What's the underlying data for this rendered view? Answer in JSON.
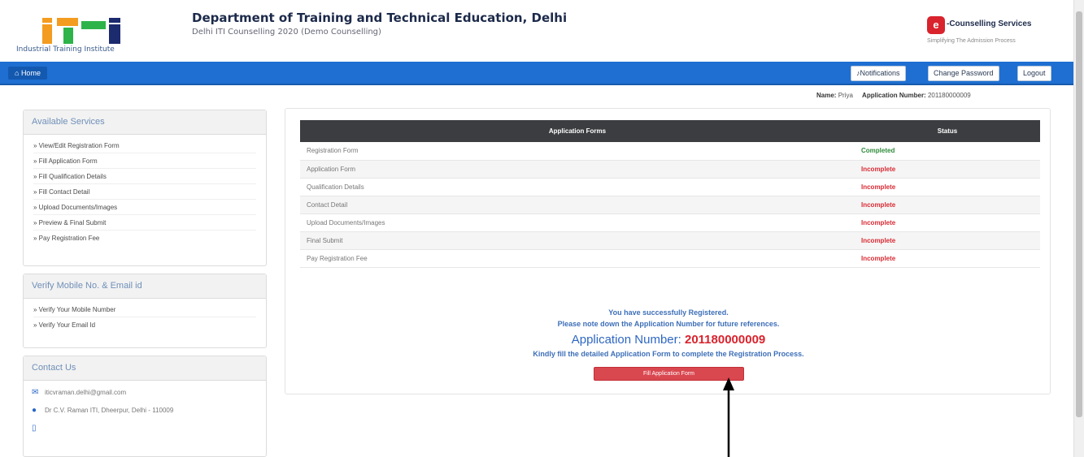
{
  "header": {
    "logo_caption": "Industrial Training Institute",
    "title": "Department of Training and Technical Education, Delhi",
    "subtitle": "Delhi ITI Counselling 2020 (Demo Counselling)",
    "brand_mark": "e",
    "brand_name": "-Counselling Services",
    "brand_tagline": "Simplifying The Admission Process",
    "logo_colors": {
      "orange": "#f39c1f",
      "green": "#2eb34a",
      "navy": "#1c2a6e"
    }
  },
  "nav": {
    "home_label": "Home",
    "notifications_label": "Notifications",
    "change_password_label": "Change Password",
    "logout_label": "Logout",
    "bar_color": "#1e6fd1"
  },
  "user": {
    "name_label": "Name:",
    "name_value": "Priya",
    "appno_label": "Application Number:",
    "appno_value": "201180000009"
  },
  "sidebar": {
    "services": {
      "title": "Available Services",
      "items": [
        "View/Edit Registration Form",
        "Fill Application Form",
        "Fill Qualification Details",
        "Fill Contact Detail",
        "Upload Documents/Images",
        "Preview & Final Submit",
        "Pay Registration Fee"
      ]
    },
    "verify": {
      "title": "Verify Mobile No. & Email id",
      "items": [
        "Verify Your Mobile Number",
        "Verify Your Email Id"
      ]
    },
    "contact": {
      "title": "Contact Us",
      "email": "iticvraman.delhi@gmail.com",
      "address": "Dr C.V. Raman ITI, Dheerpur, Delhi - 110009",
      "phone": ""
    }
  },
  "main": {
    "table": {
      "headers": [
        "Application Forms",
        "Status"
      ],
      "rows": [
        {
          "form": "Registration Form",
          "status": "Completed"
        },
        {
          "form": "Application Form",
          "status": "Incomplete"
        },
        {
          "form": "Qualification Details",
          "status": "Incomplete"
        },
        {
          "form": "Contact Detail",
          "status": "Incomplete"
        },
        {
          "form": "Upload Documents/Images",
          "status": "Incomplete"
        },
        {
          "form": "Final Submit",
          "status": "Incomplete"
        },
        {
          "form": "Pay Registration Fee",
          "status": "Incomplete"
        }
      ]
    },
    "message_line1": "You have successfully Registered.",
    "message_line2": "Please note down the Application Number for future references.",
    "appno_heading_label": "Application Number:",
    "appno_heading_value": "201180000009",
    "message_line4": "Kindly fill the detailed Application Form to complete the Registration Process.",
    "fill_button_label": "Fill Application Form",
    "colors": {
      "completed": "#2e8b3a",
      "incomplete": "#d92a33",
      "button": "#d9474f"
    }
  }
}
